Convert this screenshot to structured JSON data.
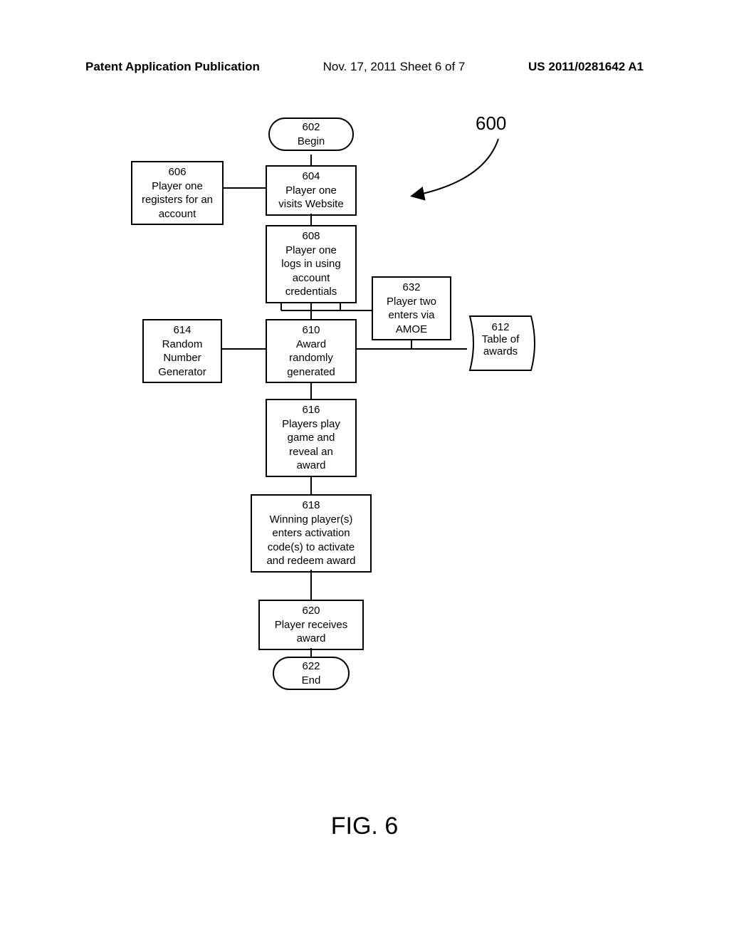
{
  "header": {
    "left": "Patent Application Publication",
    "center": "Nov. 17, 2011  Sheet 6 of 7",
    "right": "US 2011/0281642 A1"
  },
  "ref600": "600",
  "boxes": {
    "b602": {
      "num": "602",
      "text": "Begin"
    },
    "b604": {
      "num": "604",
      "text": "Player one\nvisits Website"
    },
    "b606": {
      "num": "606",
      "text": "Player one\nregisters for an\naccount"
    },
    "b608": {
      "num": "608",
      "text": "Player one\nlogs in using\naccount\ncredentials"
    },
    "b610": {
      "num": "610",
      "text": "Award\nrandomly\ngenerated"
    },
    "b612": {
      "num": "612",
      "text": "Table of\nawards"
    },
    "b614": {
      "num": "614",
      "text": "Random\nNumber\nGenerator"
    },
    "b616": {
      "num": "616",
      "text": "Players play\ngame and\nreveal an\naward"
    },
    "b618": {
      "num": "618",
      "text": "Winning player(s)\nenters activation\ncode(s) to activate\nand redeem award"
    },
    "b620": {
      "num": "620",
      "text": "Player receives\naward"
    },
    "b622": {
      "num": "622",
      "text": "End"
    },
    "b632": {
      "num": "632",
      "text": "Player two\nenters via\nAMOE"
    }
  },
  "figure": "FIG. 6"
}
